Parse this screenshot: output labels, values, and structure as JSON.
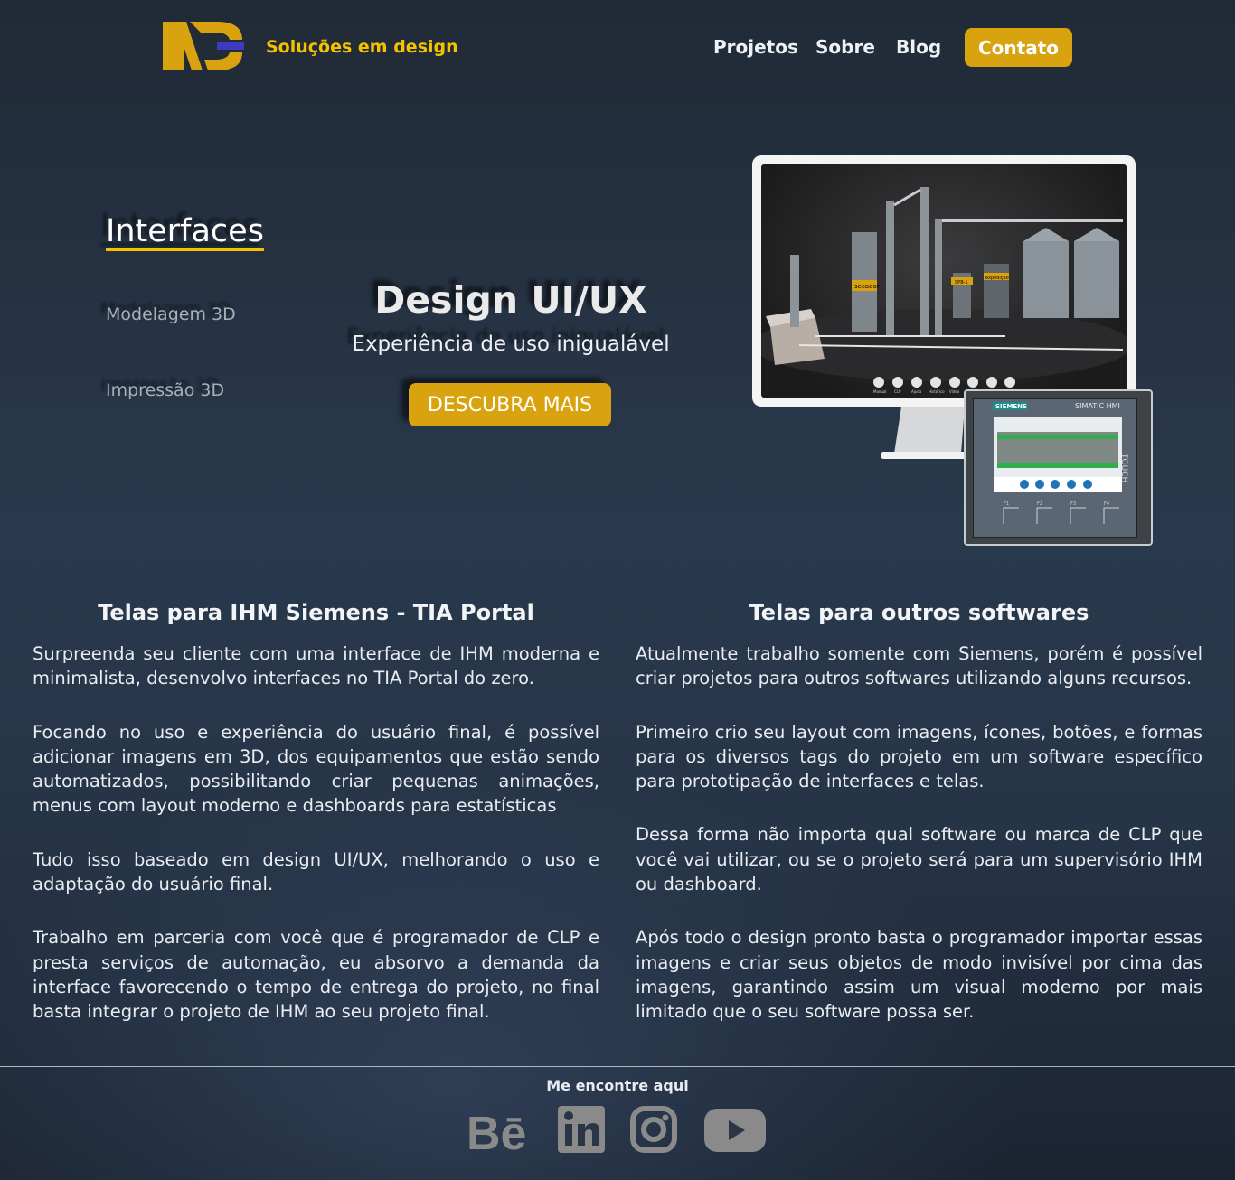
{
  "brand": {
    "tagline": "Soluções em design",
    "accent_color": "#f3c300",
    "button_color": "#d9a20f"
  },
  "nav": {
    "items": [
      "Projetos",
      "Sobre",
      "Blog"
    ],
    "cta": "Contato"
  },
  "hero": {
    "side_menu": [
      "Interfaces",
      "Modelagem 3D",
      "Impressão 3D"
    ],
    "active_item": "Interfaces",
    "title": "Design UI/UX",
    "subtitle": "Experiência de uso inigualável",
    "button": "DESCUBRA MAIS",
    "image": {
      "tank_labels": [
        "secador",
        "SPB-1",
        "expedição"
      ],
      "hmi_brand": "SIEMENS",
      "hmi_model": "SIMATIC HMI",
      "hmi_touch": "TOUCH",
      "hmi_keys": [
        "F1",
        "F2",
        "F3",
        "F4"
      ],
      "toolbar_labels": [
        "Manual",
        "CLP",
        "Ajuda",
        "Histórico",
        "Vídeo"
      ]
    }
  },
  "left_column": {
    "title": "Telas para IHM Siemens - TIA Portal",
    "paragraphs": [
      "Surpreenda seu cliente com uma interface de IHM moderna e minimalista, desenvolvo interfaces no TIA Portal do zero.",
      "Focando no uso e experiência do usuário final, é possível adicionar imagens em 3D, dos equipamentos que estão sendo automatizados, possibilitando criar pequenas animações, menus com layout moderno e dashboards para estatísticas",
      "Tudo isso baseado em design UI/UX, melhorando o uso e adaptação do usuário final.",
      "Trabalho em parceria com você que é programador de CLP e presta serviços de automação, eu absorvo a demanda da interface favorecendo o tempo de entrega do projeto, no final basta integrar o projeto de IHM ao seu projeto final."
    ]
  },
  "right_column": {
    "title": "Telas para outros softwares",
    "paragraphs": [
      "Atualmente trabalho somente com Siemens, porém é possível criar projetos para outros softwares utilizando alguns recursos.",
      "Primeiro crio seu layout com imagens, ícones, botões, e formas para os diversos tags do projeto em um software específico para prototipação de interfaces e telas.",
      "Dessa forma não importa qual software ou marca de CLP que você vai utilizar, ou se o projeto será para um supervisório IHM ou dashboard.",
      "Após todo o design pronto basta o programador importar essas imagens e criar seus objetos de modo invisível por cima das imagens, garantindo assim um visual moderno por mais limitado que o seu software possa ser."
    ]
  },
  "footer": {
    "title": "Me encontre aqui",
    "social": [
      "behance-icon",
      "linkedin-icon",
      "instagram-icon",
      "youtube-icon"
    ]
  }
}
